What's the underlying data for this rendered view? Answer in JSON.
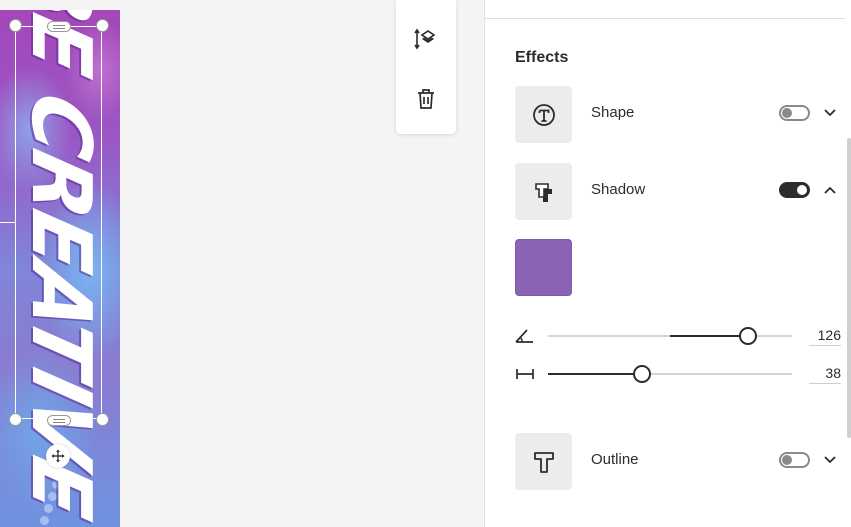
{
  "canvas": {
    "artwork_text": "BE CREATIVE"
  },
  "toolbar": {
    "arrange_icon": "layers-arrange-icon",
    "delete_icon": "trash-icon"
  },
  "effects": {
    "heading": "Effects",
    "shape": {
      "label": "Shape",
      "enabled": false,
      "expanded": false,
      "icon": "text-circle-icon"
    },
    "shadow": {
      "label": "Shadow",
      "enabled": true,
      "expanded": true,
      "icon": "text-shadow-icon",
      "color": "#8b63b5",
      "angle": {
        "icon": "angle-icon",
        "value": "126",
        "fraction": 0.82
      },
      "distance": {
        "icon": "distance-icon",
        "value": "38",
        "fraction": 0.385
      }
    },
    "outline": {
      "label": "Outline",
      "enabled": false,
      "expanded": false,
      "icon": "text-outline-icon"
    }
  }
}
